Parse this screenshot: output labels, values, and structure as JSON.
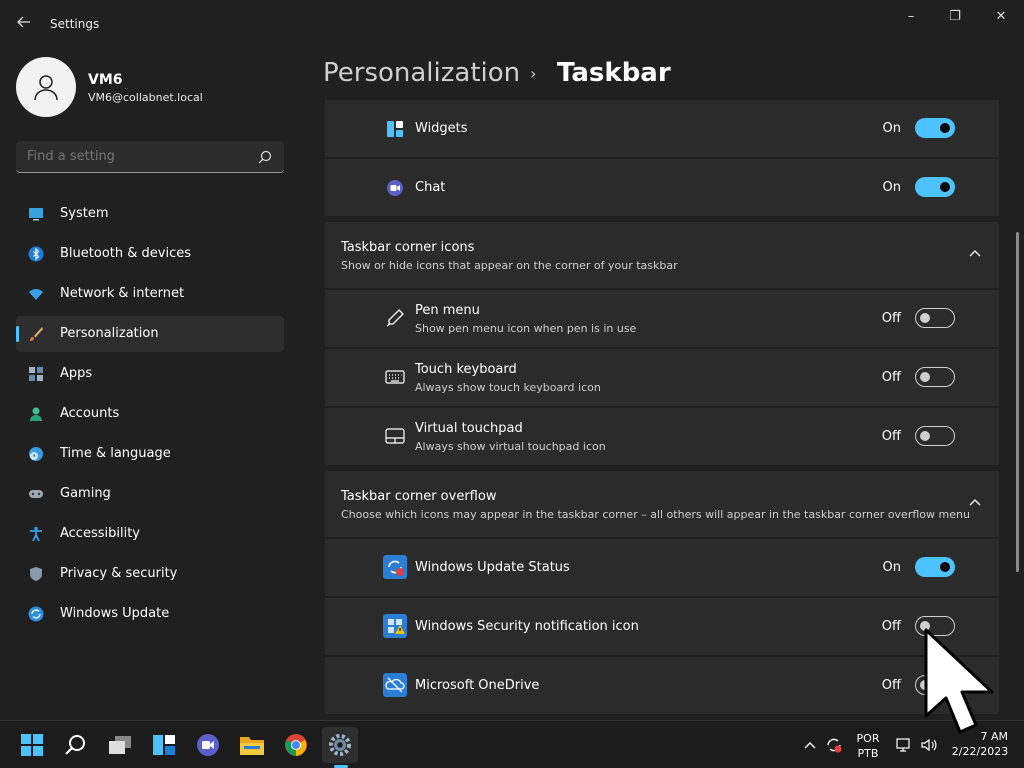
{
  "window": {
    "title": "Settings",
    "back_icon": "arrow-left-icon",
    "minimize_glyph": "–",
    "maximize_glyph": "❐",
    "close_glyph": "✕"
  },
  "profile": {
    "name": "VM6",
    "email": "VM6@collabnet.local"
  },
  "search": {
    "placeholder": "Find a setting"
  },
  "sidebar": {
    "items": [
      {
        "label": "System",
        "icon": "monitor-icon"
      },
      {
        "label": "Bluetooth & devices",
        "icon": "bluetooth-icon"
      },
      {
        "label": "Network & internet",
        "icon": "wifi-icon"
      },
      {
        "label": "Personalization",
        "icon": "paintbrush-icon",
        "selected": true
      },
      {
        "label": "Apps",
        "icon": "apps-icon"
      },
      {
        "label": "Accounts",
        "icon": "person-icon"
      },
      {
        "label": "Time & language",
        "icon": "clock-globe-icon"
      },
      {
        "label": "Gaming",
        "icon": "gamepad-icon"
      },
      {
        "label": "Accessibility",
        "icon": "accessibility-icon"
      },
      {
        "label": "Privacy & security",
        "icon": "shield-icon"
      },
      {
        "label": "Windows Update",
        "icon": "update-icon"
      }
    ]
  },
  "header": {
    "breadcrumb_parent": "Personalization",
    "separator": "›",
    "title": "Taskbar"
  },
  "taskbar_items": [
    {
      "label": "Widgets",
      "state": "On",
      "on": true,
      "icon": "widgets-icon"
    },
    {
      "label": "Chat",
      "state": "On",
      "on": true,
      "icon": "chat-icon"
    }
  ],
  "corner_icons": {
    "title": "Taskbar corner icons",
    "subtitle": "Show or hide icons that appear on the corner of your taskbar",
    "items": [
      {
        "label": "Pen menu",
        "sub": "Show pen menu icon when pen is in use",
        "state": "Off",
        "on": false,
        "icon": "pen-icon"
      },
      {
        "label": "Touch keyboard",
        "sub": "Always show touch keyboard icon",
        "state": "Off",
        "on": false,
        "icon": "keyboard-icon"
      },
      {
        "label": "Virtual touchpad",
        "sub": "Always show virtual touchpad icon",
        "state": "Off",
        "on": false,
        "icon": "touchpad-icon"
      }
    ]
  },
  "corner_overflow": {
    "title": "Taskbar corner overflow",
    "subtitle": "Choose which icons may appear in the taskbar corner – all others will appear in the taskbar corner overflow menu",
    "items": [
      {
        "label": "Windows Update Status",
        "state": "On",
        "on": true,
        "icon": "windows-update-status-icon"
      },
      {
        "label": "Windows Security notification icon",
        "state": "Off",
        "on": false,
        "icon": "windows-security-icon"
      },
      {
        "label": "Microsoft OneDrive",
        "state": "Off",
        "on": false,
        "icon": "onedrive-icon"
      }
    ]
  },
  "system_taskbar": {
    "lang_top": "POR",
    "lang_bottom": "PTB",
    "time": "7 AM",
    "date": "2/22/2023",
    "apps": [
      "start-icon",
      "search-icon",
      "task-view-icon",
      "widgets-icon",
      "teams-chat-icon",
      "file-explorer-icon",
      "chrome-icon",
      "settings-icon"
    ]
  },
  "colors": {
    "accent": "#4cc2ff",
    "background": "#202020",
    "card": "#2b2b2b"
  }
}
